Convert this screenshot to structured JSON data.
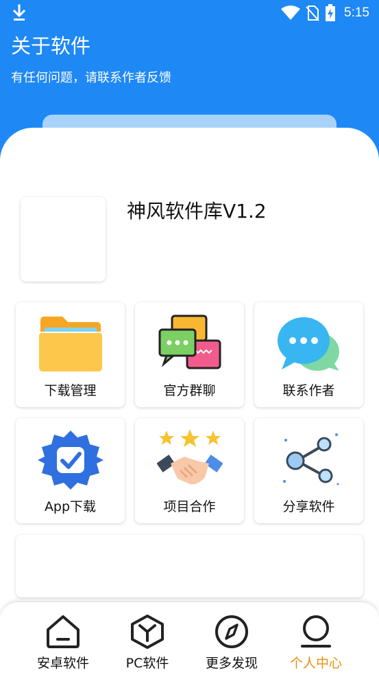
{
  "status_bar": {
    "time": "5:15"
  },
  "header": {
    "title": "关于软件",
    "subtitle": "有任何问题，请联系作者反馈"
  },
  "app": {
    "name": "神风软件库V1.2"
  },
  "grid": [
    {
      "label": "下载管理",
      "icon": "folder-icon"
    },
    {
      "label": "官方群聊",
      "icon": "chat-bubbles-icon"
    },
    {
      "label": "联系作者",
      "icon": "message-icon"
    },
    {
      "label": "App下载",
      "icon": "verified-badge-icon"
    },
    {
      "label": "项目合作",
      "icon": "handshake-icon"
    },
    {
      "label": "分享软件",
      "icon": "share-icon"
    }
  ],
  "bottom_nav": [
    {
      "label": "安卓软件",
      "icon": "home-icon"
    },
    {
      "label": "PC软件",
      "icon": "cube-icon"
    },
    {
      "label": "更多发现",
      "icon": "compass-icon"
    },
    {
      "label": "个人中心",
      "icon": "profile-icon",
      "active": true
    }
  ],
  "colors": {
    "header": "#1e88f5",
    "active_nav": "#e8900c"
  }
}
